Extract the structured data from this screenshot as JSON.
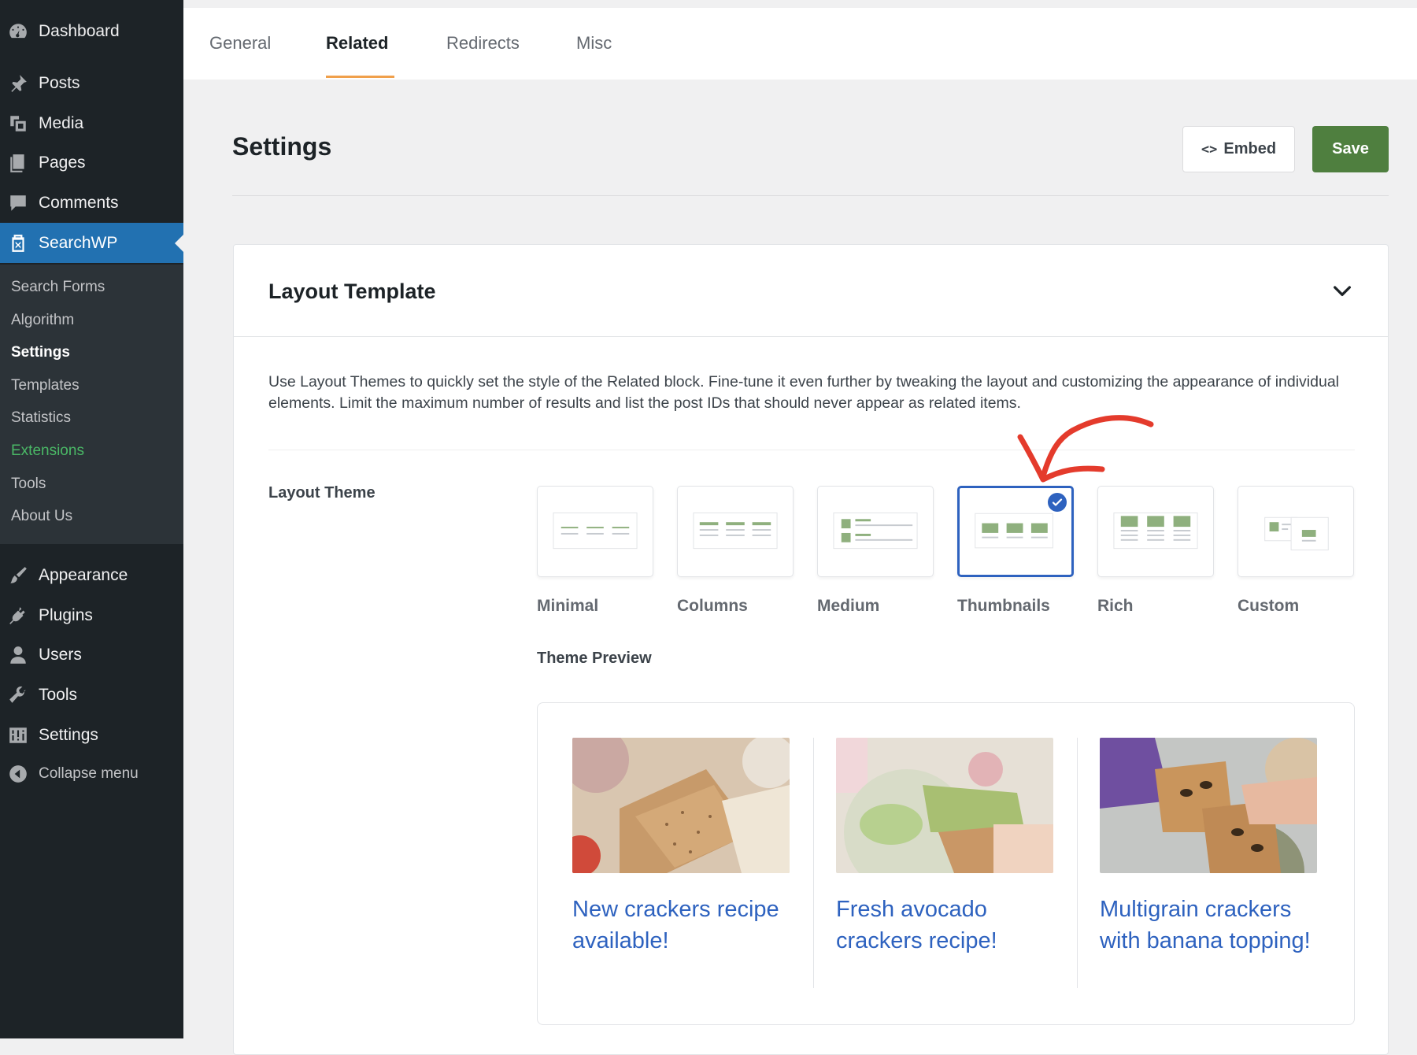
{
  "sidebar": {
    "top": [
      {
        "label": "Dashboard",
        "icon": "dashboard-icon"
      },
      {
        "label": "Posts",
        "icon": "pin-icon"
      },
      {
        "label": "Media",
        "icon": "media-icon"
      },
      {
        "label": "Pages",
        "icon": "pages-icon"
      },
      {
        "label": "Comments",
        "icon": "comment-icon"
      },
      {
        "label": "SearchWP",
        "icon": "searchwp-icon"
      }
    ],
    "submenu": [
      "Search Forms",
      "Algorithm",
      "Settings",
      "Templates",
      "Statistics",
      "Extensions",
      "Tools",
      "About Us"
    ],
    "bottom": [
      {
        "label": "Appearance",
        "icon": "brush-icon"
      },
      {
        "label": "Plugins",
        "icon": "plug-icon"
      },
      {
        "label": "Users",
        "icon": "user-icon"
      },
      {
        "label": "Tools",
        "icon": "wrench-icon"
      },
      {
        "label": "Settings",
        "icon": "sliders-icon"
      }
    ],
    "collapse": "Collapse menu"
  },
  "tabs": [
    "General",
    "Related",
    "Redirects",
    "Misc"
  ],
  "header": {
    "title": "Settings",
    "embed_label": "Embed",
    "embed_glyph": "<>",
    "save_label": "Save"
  },
  "card": {
    "title": "Layout Template",
    "description": "Use Layout Themes to quickly set the style of the Related block. Fine-tune it even further by tweaking the layout and customizing the appearance of individual elements. Limit the maximum number of results and list the post IDs that should never appear as related items.",
    "layout_theme_label": "Layout Theme",
    "themes": [
      "Minimal",
      "Columns",
      "Medium",
      "Thumbnails",
      "Rich",
      "Custom"
    ],
    "selected_theme": "Thumbnails",
    "theme_preview_label": "Theme Preview",
    "preview_items": [
      {
        "title": "New crackers recipe available!"
      },
      {
        "title": "Fresh avocado crackers recipe!"
      },
      {
        "title": "Multigrain crackers with banana topping!"
      }
    ]
  },
  "colors": {
    "sidebar_bg": "#1d2327",
    "active_blue": "#2271b1",
    "save_green": "#4f7f3f",
    "link_blue": "#2e62bf",
    "tab_accent": "#f0a04b",
    "arrow_red": "#e43b2c"
  }
}
